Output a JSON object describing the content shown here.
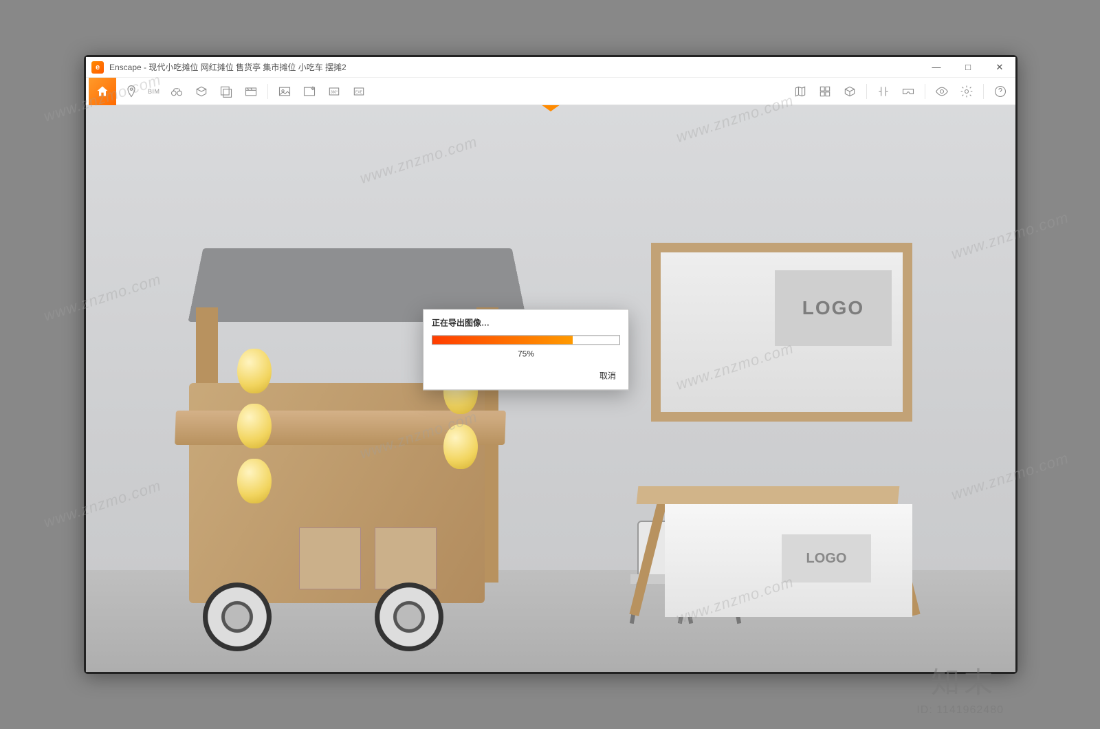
{
  "window": {
    "app_name": "Enscape",
    "title_separator": " - ",
    "document_title": "现代小吃摊位 网红摊位 售货亭 集市摊位 小吃车 摆摊2",
    "app_icon_letter": "e",
    "min_icon": "—",
    "max_icon": "□",
    "close_icon": "✕"
  },
  "toolbar": {
    "home_icon": "⌂",
    "bim_label": "BIM",
    "icons": {
      "pin": "location-pin-icon",
      "binoculars": "binoculars-icon",
      "cube_a": "perspective-icon",
      "cube_b": "views-icon",
      "clapper": "video-icon",
      "export_img": "export-image-icon",
      "export_img2": "export-image-alt-icon",
      "pano": "panorama-icon",
      "exe": "exe-export-icon",
      "map": "minimap-icon",
      "assets": "asset-library-icon",
      "box": "package-icon",
      "compare": "compare-icon",
      "vr": "vr-headset-icon",
      "eye": "visual-settings-icon",
      "gear": "settings-icon",
      "help": "help-icon"
    }
  },
  "viewport": {
    "logo_text": "LOGO",
    "watermark_url": "www.znzmo.com",
    "brand_watermark": "知末",
    "id_label": "ID: 1141962480"
  },
  "dialog": {
    "title": "正在导出图像…",
    "progress_percent": 75,
    "percent_label": "75%",
    "cancel_label": "取消"
  }
}
